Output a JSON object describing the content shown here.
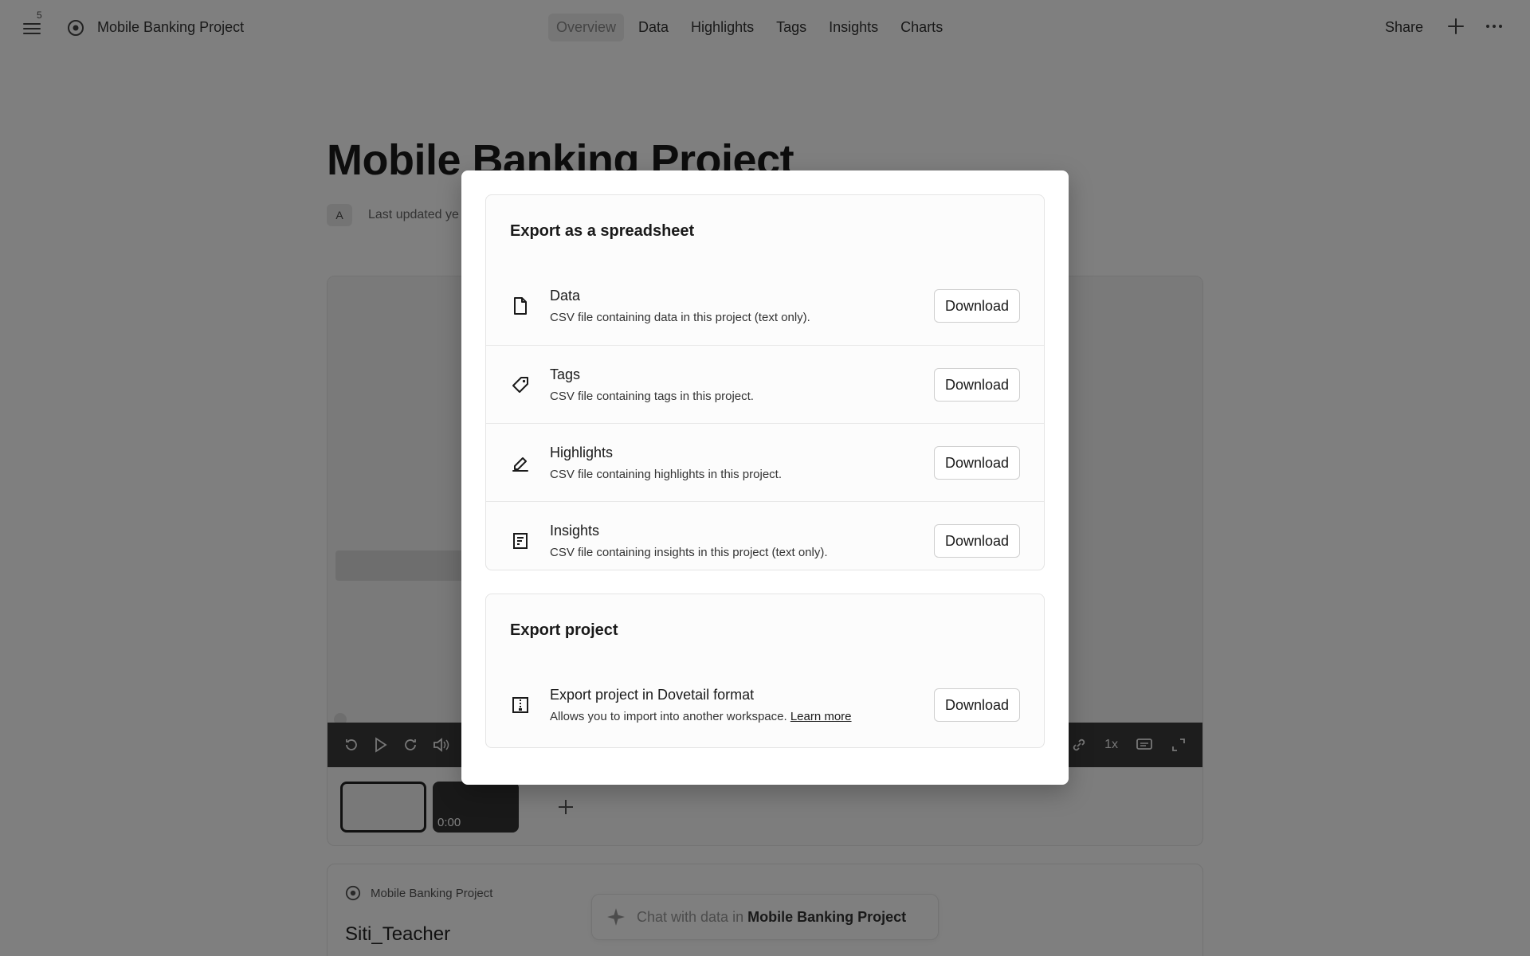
{
  "topbar": {
    "menu_badge": "5",
    "project_name": "Mobile Banking Project",
    "tabs": [
      {
        "label": "Overview",
        "active": true
      },
      {
        "label": "Data"
      },
      {
        "label": "Highlights"
      },
      {
        "label": "Tags"
      },
      {
        "label": "Insights"
      },
      {
        "label": "Charts"
      }
    ],
    "share_label": "Share"
  },
  "page": {
    "title": "Mobile Banking Project",
    "avatar_initial": "A",
    "last_updated": "Last updated ye"
  },
  "media": {
    "speed": "1x",
    "thumb_time": "0:00"
  },
  "bottom_card": {
    "crumb": "Mobile Banking Project",
    "title": "Siti_Teacher"
  },
  "chat": {
    "prefix": "Chat with data in ",
    "project": "Mobile Banking Project"
  },
  "modal": {
    "spreadsheet": {
      "title": "Export as a spreadsheet",
      "items": [
        {
          "icon": "file-icon",
          "title": "Data",
          "desc": "CSV file containing data in this project (text only).",
          "button": "Download"
        },
        {
          "icon": "tag-icon",
          "title": "Tags",
          "desc": "CSV file containing tags in this project.",
          "button": "Download"
        },
        {
          "icon": "highlighter-icon",
          "title": "Highlights",
          "desc": "CSV file containing highlights in this project.",
          "button": "Download"
        },
        {
          "icon": "insight-doc-icon",
          "title": "Insights",
          "desc": "CSV file containing insights in this project (text only).",
          "button": "Download"
        }
      ]
    },
    "project": {
      "title": "Export project",
      "item": {
        "icon": "archive-icon",
        "title": "Export project in Dovetail format",
        "desc": "Allows you to import into another workspace. ",
        "link": "Learn more",
        "button": "Download"
      }
    }
  }
}
